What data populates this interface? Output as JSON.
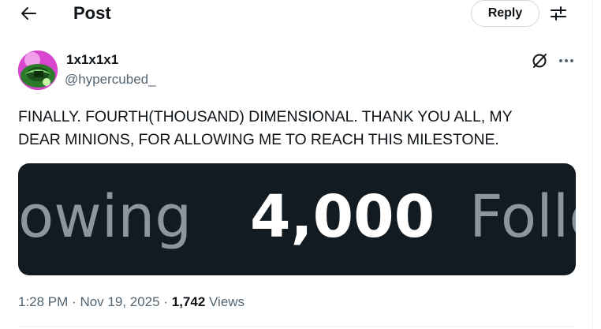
{
  "header": {
    "title": "Post",
    "reply_label": "Reply"
  },
  "author": {
    "display_name": "1x1x1x1",
    "handle": "@hypercubed_"
  },
  "post": {
    "text_line1": "FINALLY. FOURTH(THOUSAND) DIMENSIONAL. THANK YOU ALL, MY",
    "text_line2": "DEAR MINIONS, FOR ALLOWING ME TO REACH THIS MILESTONE."
  },
  "media": {
    "left_text": "owing",
    "count_text": "4,000",
    "right_text": "Follo",
    "background": "#131b22"
  },
  "meta": {
    "time": "1:28 PM",
    "separator": "·",
    "date": "Nov 19, 2025",
    "views_count": "1,742",
    "views_label": "Views"
  },
  "icons": {
    "back": "arrow-left-icon",
    "settings": "sliders-icon",
    "grok": "grok-icon",
    "more": "more-horizontal-icon"
  },
  "colors": {
    "text_primary": "#0f1419",
    "text_secondary": "#536471",
    "border": "#cfd9de"
  }
}
